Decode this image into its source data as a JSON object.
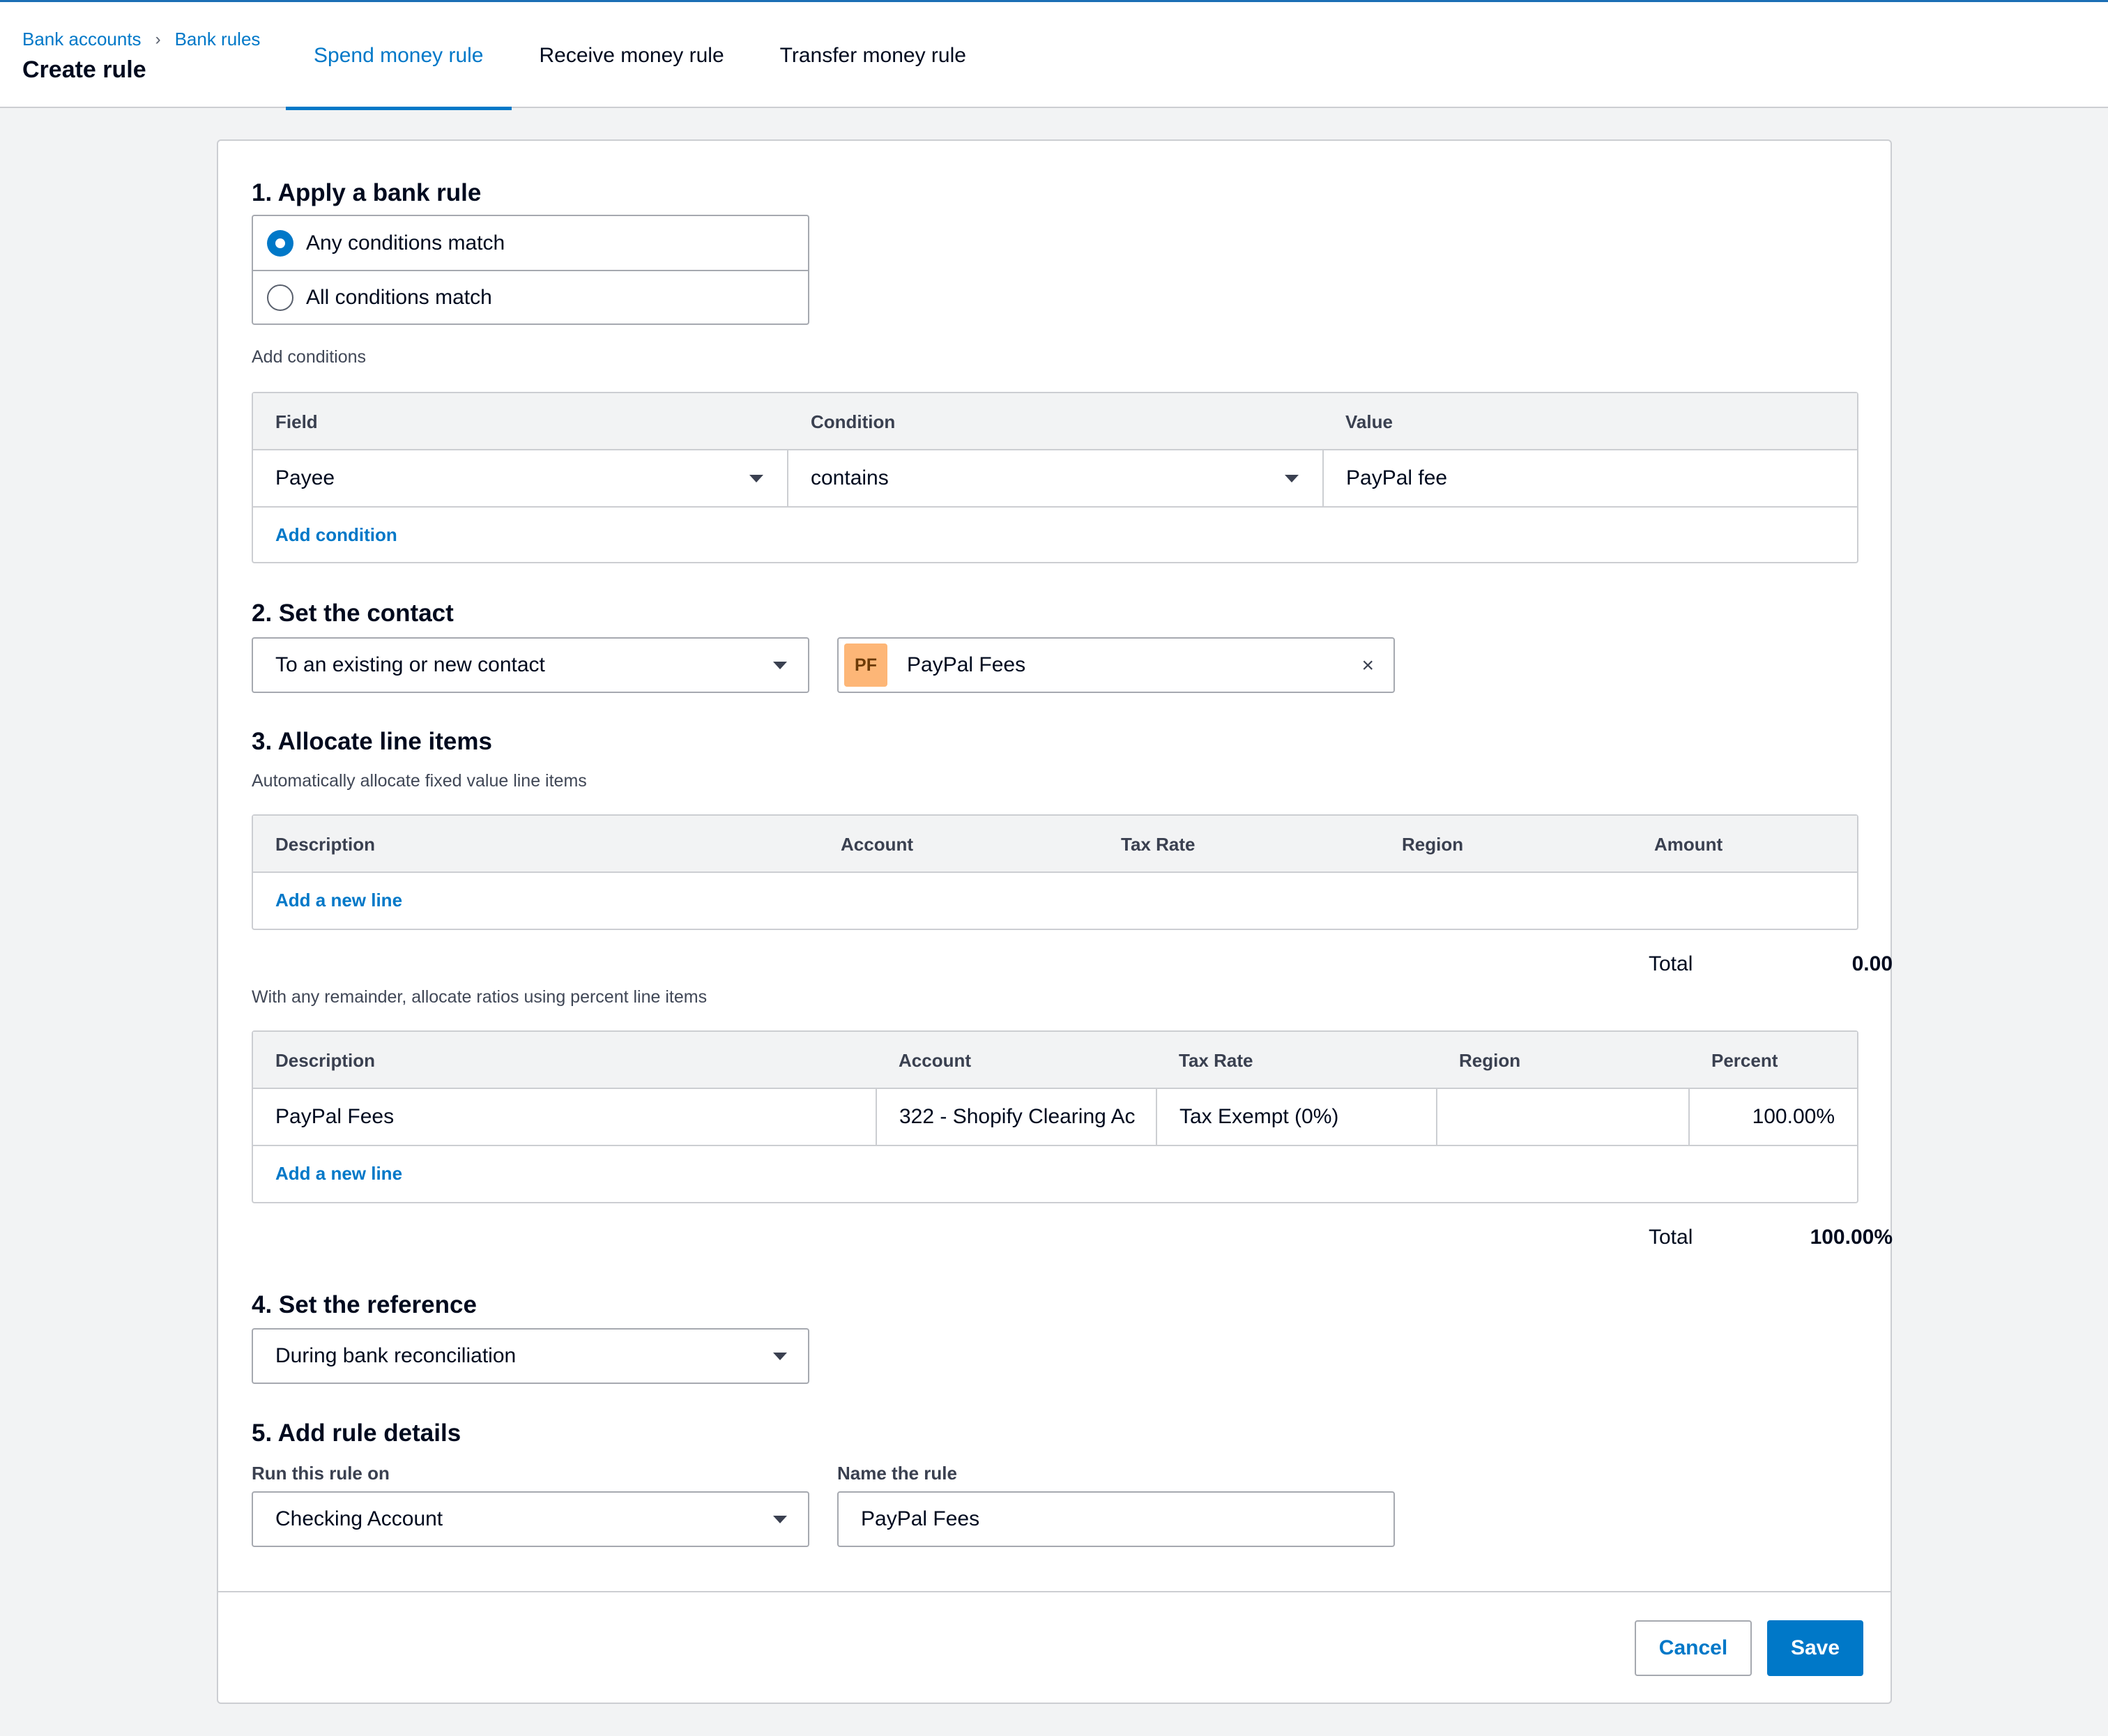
{
  "breadcrumb": {
    "item1": "Bank accounts",
    "item2": "Bank rules",
    "separator": "›"
  },
  "page_title": "Create rule",
  "tabs": [
    {
      "label": "Spend money rule",
      "active": true
    },
    {
      "label": "Receive money rule",
      "active": false
    },
    {
      "label": "Transfer money rule",
      "active": false
    }
  ],
  "section1": {
    "title": "1. Apply a bank rule",
    "options": [
      "Any conditions match",
      "All conditions match"
    ],
    "selected": "Any conditions match",
    "add_conditions_label": "Add conditions",
    "table": {
      "headers": {
        "field": "Field",
        "condition": "Condition",
        "value": "Value"
      },
      "row": {
        "field": "Payee",
        "condition": "contains",
        "value": "PayPal fee"
      },
      "add_link": "Add condition"
    }
  },
  "section2": {
    "title": "2. Set the contact",
    "contact_mode": "To an existing or new contact",
    "contact": {
      "initials": "PF",
      "name": "PayPal Fees",
      "clear_icon": "×"
    }
  },
  "section3": {
    "title": "3. Allocate line items",
    "fixed_hint": "Automatically allocate fixed value line items",
    "fixed_table": {
      "headers": {
        "description": "Description",
        "account": "Account",
        "tax_rate": "Tax Rate",
        "region": "Region",
        "amount": "Amount"
      },
      "add_link": "Add a new line"
    },
    "fixed_total": {
      "label": "Total",
      "value": "0.00"
    },
    "percent_hint": "With any remainder, allocate ratios using percent line items",
    "percent_table": {
      "headers": {
        "description": "Description",
        "account": "Account",
        "tax_rate": "Tax Rate",
        "region": "Region",
        "percent": "Percent"
      },
      "row": {
        "description": "PayPal Fees",
        "account": "322 - Shopify Clearing Ac",
        "tax_rate": "Tax Exempt (0%)",
        "region": "",
        "percent": "100.00%"
      },
      "add_link": "Add a new line"
    },
    "percent_total": {
      "label": "Total",
      "value": "100.00%"
    }
  },
  "section4": {
    "title": "4. Set the reference",
    "reference": "During bank reconciliation"
  },
  "section5": {
    "title": "5. Add rule details",
    "run_on_label": "Run this rule on",
    "run_on": "Checking Account",
    "name_label": "Name the rule",
    "name": "PayPal Fees"
  },
  "actions": {
    "cancel": "Cancel",
    "save": "Save"
  },
  "colors": {
    "accent": "#0078c8",
    "avatar": "#fdb677"
  }
}
